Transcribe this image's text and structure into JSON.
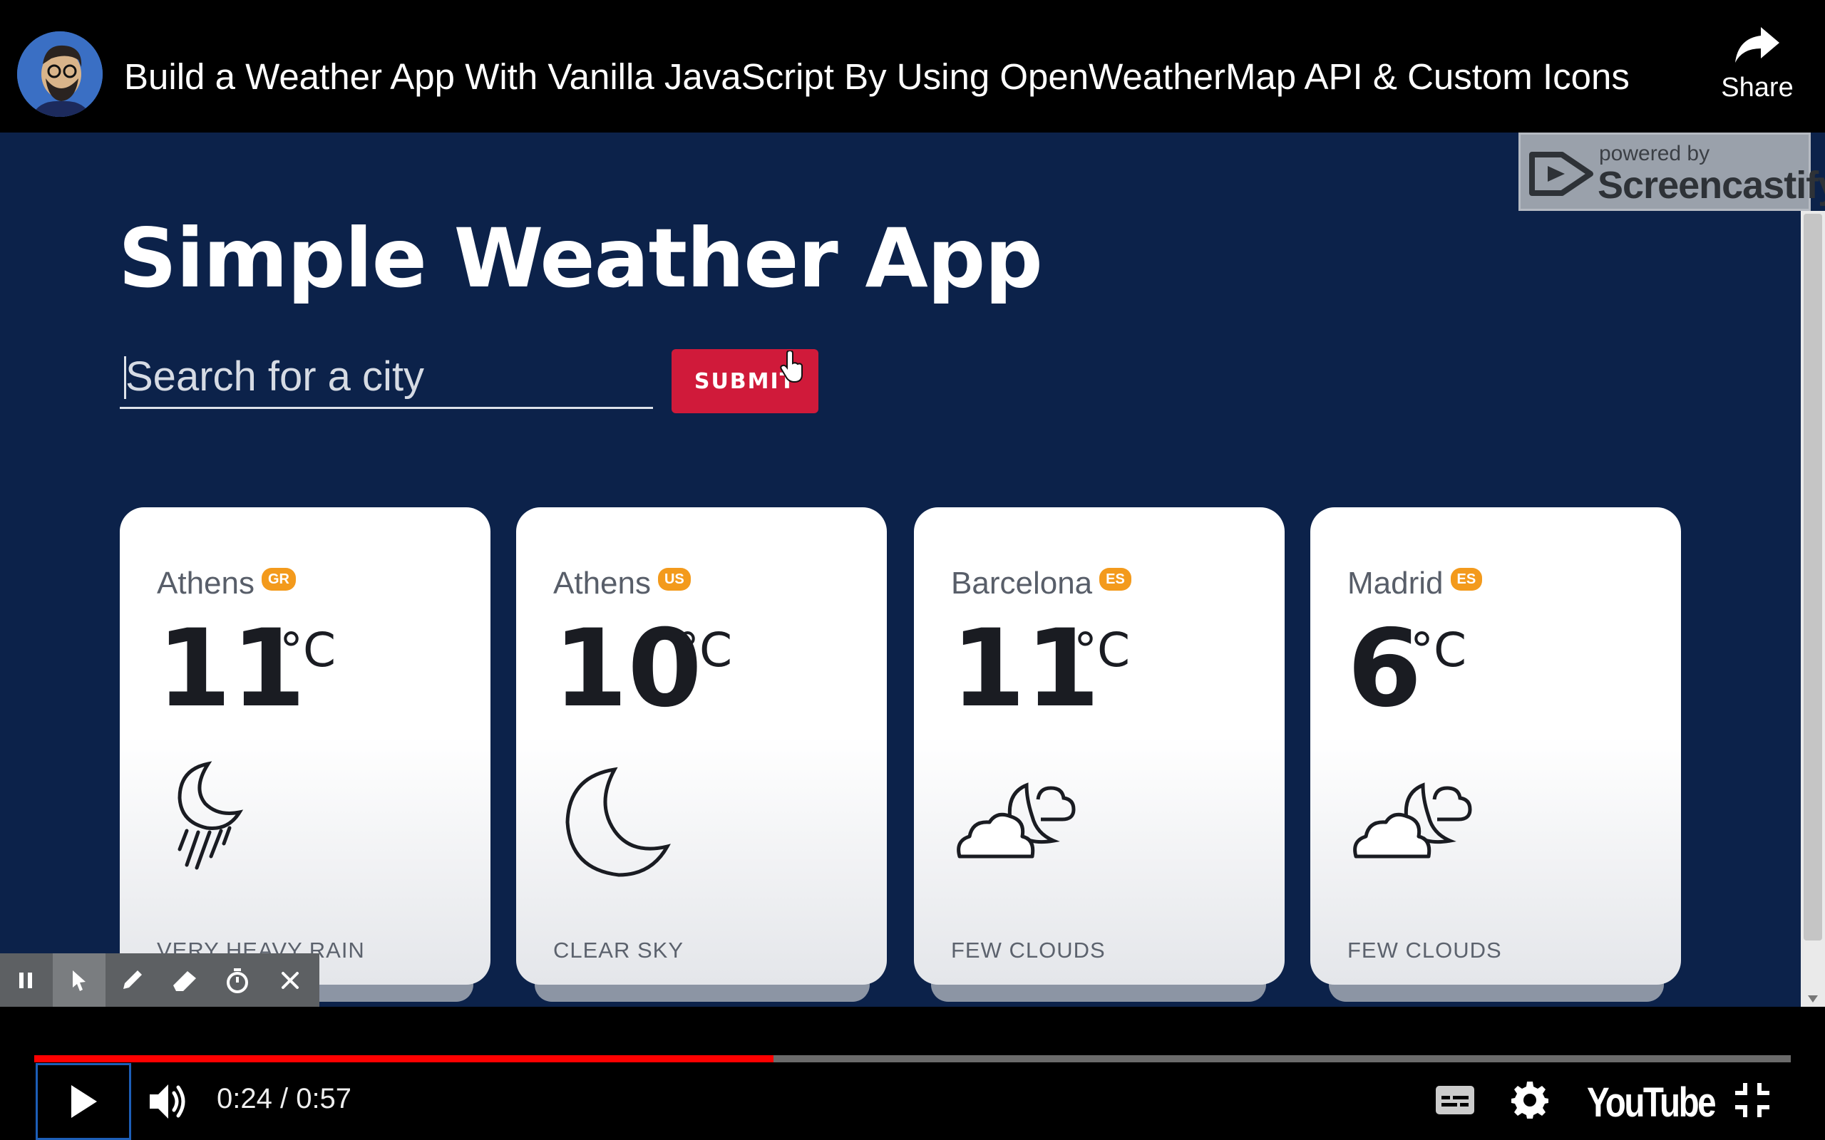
{
  "header": {
    "video_title": "Build a Weather App With Vanilla JavaScript By Using OpenWeatherMap API & Custom Icons",
    "share_label": "Share",
    "avatar_icon": "channel-avatar"
  },
  "app": {
    "title": "Simple Weather App",
    "search_placeholder": "Search for a city",
    "submit_label": "SUBMIT",
    "accent_color": "#d01a3a",
    "background_color": "#0c224a",
    "cards": [
      {
        "city": "Athens",
        "country": "GR",
        "temp": "11",
        "unit": "°C",
        "description": "VERY HEAVY RAIN",
        "icon": "moon-rain-icon"
      },
      {
        "city": "Athens",
        "country": "US",
        "temp": "10",
        "unit": "°C",
        "description": "CLEAR SKY",
        "icon": "moon-icon"
      },
      {
        "city": "Barcelona",
        "country": "ES",
        "temp": "11",
        "unit": "°C",
        "description": "FEW CLOUDS",
        "icon": "moon-cloud-icon"
      },
      {
        "city": "Madrid",
        "country": "ES",
        "temp": "6",
        "unit": "°C",
        "description": "FEW CLOUDS",
        "icon": "moon-cloud-icon"
      }
    ]
  },
  "watermark": {
    "powered_by": "powered by",
    "brand": "Screencastify"
  },
  "screencastify_toolbar": {
    "tools": [
      "pause-icon",
      "pointer-icon",
      "pen-icon",
      "eraser-icon",
      "timer-icon",
      "close-icon"
    ]
  },
  "player": {
    "current_time": "0:24",
    "duration": "0:57",
    "time_display": "0:24 / 0:57",
    "progress_fraction": 0.421,
    "progress_color": "#ff0000",
    "logo_text": "YouTube"
  }
}
